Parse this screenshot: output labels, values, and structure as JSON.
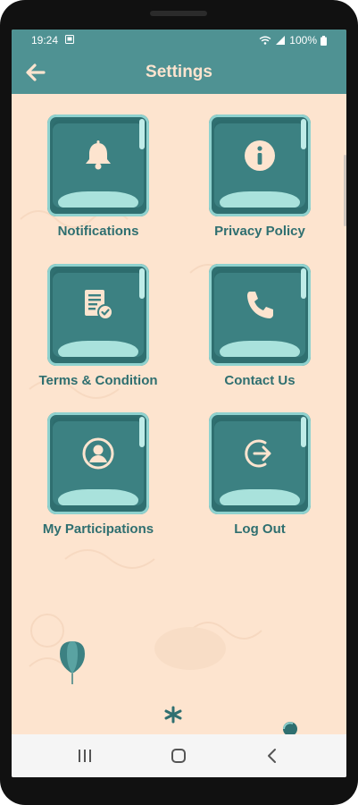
{
  "status_bar": {
    "time": "19:24",
    "battery": "100%"
  },
  "header": {
    "title": "Settings",
    "back_icon": "arrow-left-icon"
  },
  "menu": {
    "items": [
      {
        "label": "Notifications",
        "icon": "bell-icon"
      },
      {
        "label": "Privacy Policy",
        "icon": "info-icon"
      },
      {
        "label": "Terms & Condition",
        "icon": "document-check-icon"
      },
      {
        "label": "Contact Us",
        "icon": "phone-icon"
      },
      {
        "label": "My Participations",
        "icon": "user-circle-icon"
      },
      {
        "label": "Log Out",
        "icon": "logout-icon"
      }
    ]
  },
  "colors": {
    "accent": "#4f9293",
    "background": "#fde4cf",
    "tile": "#2f6f70",
    "text": "#2f6f70"
  }
}
